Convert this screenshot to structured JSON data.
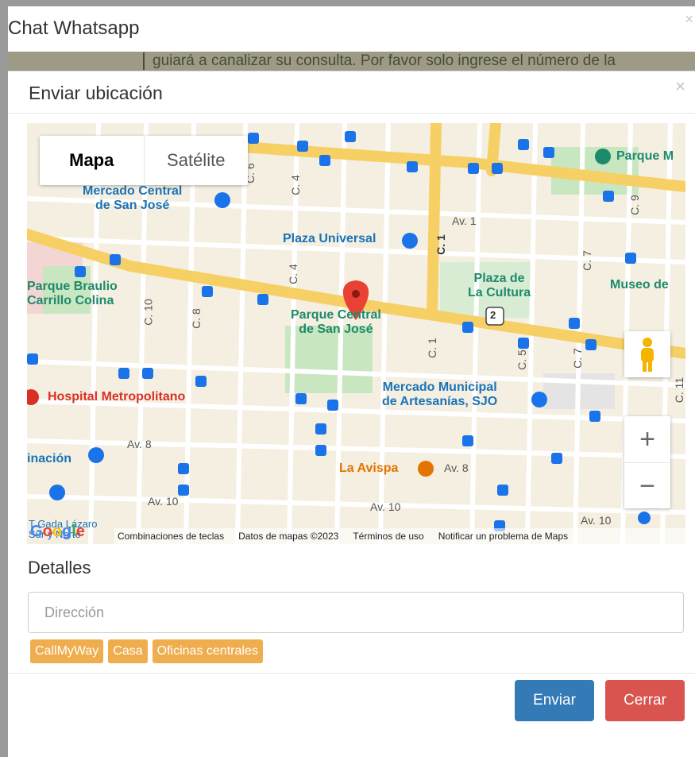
{
  "outer": {
    "title": "Chat Whatsapp",
    "close": "×",
    "background_text": "guiará a canalizar su consulta. Por favor solo ingrese el número de la"
  },
  "modal": {
    "title": "Enviar ubicación",
    "close": "×"
  },
  "map": {
    "map_types": [
      "Mapa",
      "Satélite"
    ],
    "places": {
      "mercado_central": [
        "Mercado Central",
        "de San José"
      ],
      "plaza_universal": "Plaza Universal",
      "parque_m": "Parque M",
      "plaza_cultura": [
        "Plaza de",
        "La Cultura"
      ],
      "museo": "Museo de",
      "parque_braulio": [
        "Parque Braulio",
        "Carrillo Colina"
      ],
      "parque_central": [
        "Parque Central",
        "de San José"
      ],
      "hospital": "Hospital Metropolitano",
      "mercado_municipal": [
        "Mercado Municipal",
        "de Artesanías, SJO"
      ],
      "la_avispa": "La Avispa",
      "inacion": "inación",
      "tgs": [
        "T Gada Lázaro",
        "Sur y Norte"
      ]
    },
    "streets": {
      "av1": "Av. 1",
      "av8_left": "Av. 8",
      "av8_right": "Av. 8",
      "av10_left": "Av. 10",
      "av10_mid": "Av. 10",
      "av10_right": "Av. 10",
      "c4_top": "C. 4",
      "c6": "C. 6",
      "c1": "C. 1",
      "c7_top": "C. 7",
      "c9": "C. 9",
      "c4_mid": "C. 4",
      "c8": "C. 8",
      "c10": "C. 10",
      "c1_mid": "C. 1",
      "c5": "C. 5",
      "c7_mid": "C. 7",
      "c11": "C. 11",
      "route_badge": "2"
    },
    "zoom_in": "+",
    "zoom_out": "−",
    "google_logo": [
      "G",
      "o",
      "o",
      "g",
      "l",
      "e"
    ],
    "attribution": [
      "Combinaciones de teclas",
      "Datos de mapas ©2023",
      "Términos de uso",
      "Notificar un problema de Maps"
    ]
  },
  "details": {
    "label": "Detalles",
    "address_placeholder": "Dirección",
    "tags": [
      "CallMyWay",
      "Casa",
      "Oficinas centrales"
    ]
  },
  "buttons": {
    "send": "Enviar",
    "close": "Cerrar"
  },
  "colors": {
    "primary": "#337ab7",
    "danger": "#d9534f",
    "warning": "#f0ad4e",
    "marker": "#d93025"
  }
}
